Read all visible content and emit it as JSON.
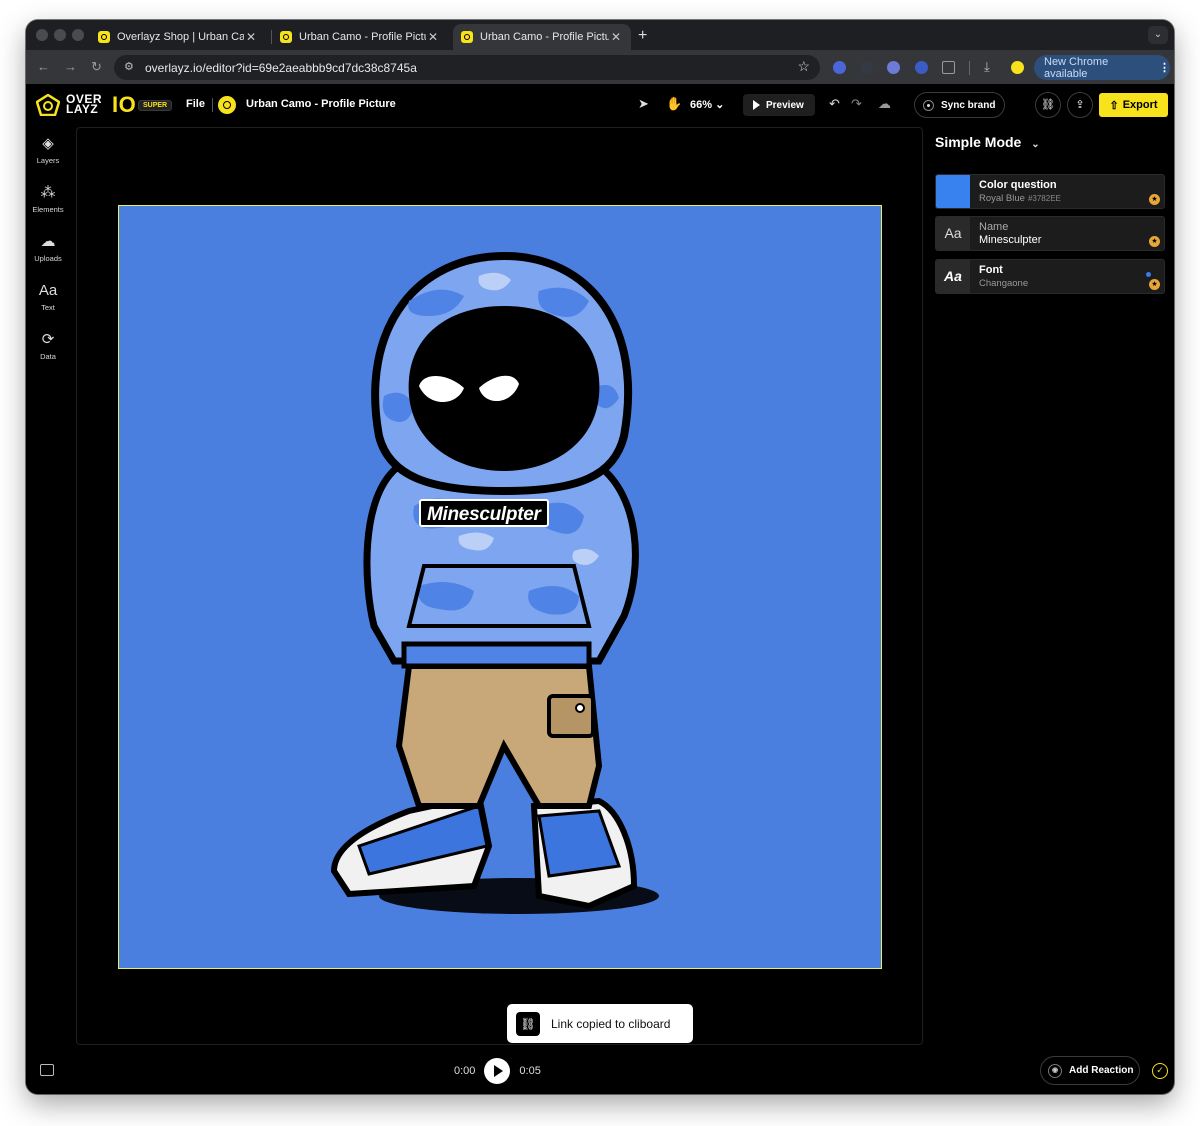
{
  "browser": {
    "tabs": [
      {
        "title": "Overlayz Shop | Urban Camo",
        "active": false
      },
      {
        "title": "Urban Camo - Profile Picture",
        "active": false
      },
      {
        "title": "Urban Camo - Profile Picture",
        "active": true
      }
    ],
    "new_tab_label": "+",
    "address": "overlayz.io/editor?id=69e2aeabbb9cd7dc38c8745a",
    "update_label": "New Chrome available",
    "extension_colors": [
      "#4a66d9",
      "#333a44",
      "#6d7ad6",
      "#3b5cc4",
      "#777777"
    ]
  },
  "app": {
    "brand_top": "OVER",
    "brand_bottom": "LAYZ",
    "brand_io": "IO",
    "plan_badge": "SUPER",
    "file_menu": "File",
    "document_title": "Urban Camo - Profile Picture",
    "zoom": "66%",
    "preview_label": "Preview",
    "sync_brand_label": "Sync brand",
    "export_label": "Export",
    "accent": "#F7E21C"
  },
  "sidebar": {
    "items": [
      {
        "label": "Layers",
        "icon": "layers-icon"
      },
      {
        "label": "Elements",
        "icon": "elements-icon"
      },
      {
        "label": "Uploads",
        "icon": "upload-cloud-icon"
      },
      {
        "label": "Text",
        "icon": "text-icon"
      },
      {
        "label": "Data",
        "icon": "data-icon"
      }
    ]
  },
  "canvas": {
    "background": "#3782EE",
    "name_text": "Minesculpter",
    "toast": "Link copied to cliboard"
  },
  "timeline": {
    "current": "0:00",
    "duration": "0:05"
  },
  "panel": {
    "mode_label": "Simple Mode",
    "fields": [
      {
        "label": "Color question",
        "value": "Royal Blue",
        "hex": "#3782EE"
      },
      {
        "label": "Name",
        "value": "Minesculpter",
        "icon_text": "Aa"
      },
      {
        "label": "Font",
        "value": "Changaone",
        "icon_text": "Aa"
      }
    ]
  },
  "footer": {
    "reaction_label": "Add Reaction"
  }
}
